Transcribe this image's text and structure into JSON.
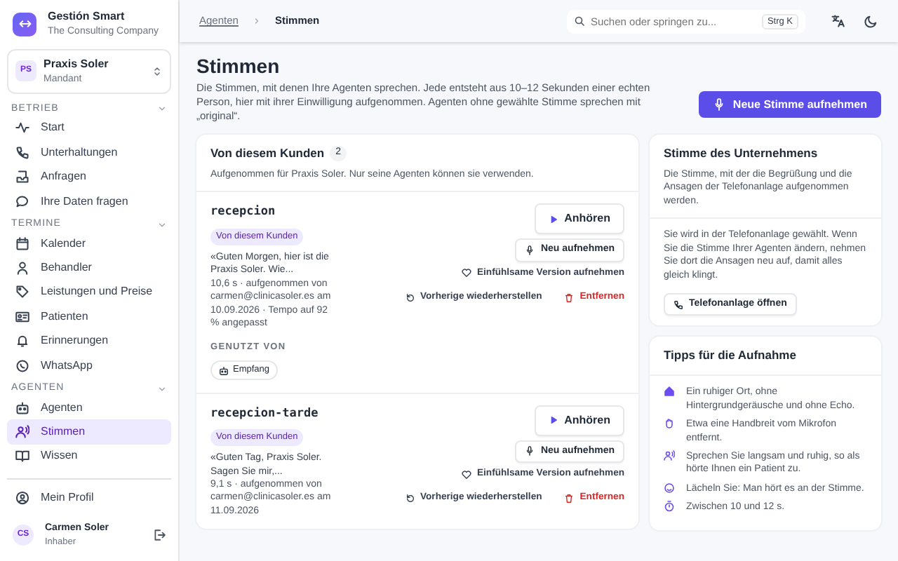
{
  "app": {
    "name": "Gestión Smart",
    "company": "The Consulting Company"
  },
  "tenant": {
    "initials": "PS",
    "name": "Praxis Soler",
    "role": "Mandant"
  },
  "sidebar": {
    "sections": [
      {
        "title": "BETRIEB",
        "expanded": true,
        "items": [
          {
            "label": "Start",
            "selected": false
          },
          {
            "label": "Unterhaltungen",
            "selected": false
          },
          {
            "label": "Anfragen",
            "selected": false
          },
          {
            "label": "Ihre Daten fragen",
            "selected": false
          }
        ]
      },
      {
        "title": "TERMINE",
        "expanded": true,
        "items": [
          {
            "label": "Kalender",
            "selected": false
          },
          {
            "label": "Behandler",
            "selected": false
          },
          {
            "label": "Leistungen und Preise",
            "selected": false
          },
          {
            "label": "Patienten",
            "selected": false
          },
          {
            "label": "Erinnerungen",
            "selected": false
          },
          {
            "label": "WhatsApp",
            "selected": false
          }
        ]
      },
      {
        "title": "AGENTEN",
        "expanded": true,
        "items": [
          {
            "label": "Agenten",
            "selected": false
          },
          {
            "label": "Stimmen",
            "selected": true
          },
          {
            "label": "Wissen",
            "selected": false
          }
        ]
      }
    ],
    "profile_link": "Mein Profil",
    "user": {
      "initials": "CS",
      "name": "Carmen Soler",
      "role": "Inhaber"
    }
  },
  "breadcrumb": [
    "Agenten",
    "Stimmen"
  ],
  "search": {
    "placeholder": "Suchen oder springen zu...",
    "shortcut": "Strg K"
  },
  "page": {
    "title": "Stimmen",
    "description": "Die Stimmen, mit denen Ihre Agenten sprechen. Jede entsteht aus 10–12 Sekunden einer echten Person, hier mit ihrer Einwilligung aufgenommen. Agenten ohne gewählte Stimme sprechen mit „original“.",
    "primary_button": "Neue Stimme aufnehmen"
  },
  "client_voices": {
    "title": "Von diesem Kunden",
    "count": "2",
    "subtitle": "Aufgenommen für Praxis Soler. Nur seine Agenten können sie verwenden.",
    "voices": [
      {
        "name": "recepcion",
        "badge": "Von diesem Kunden",
        "quote": "«Guten Morgen, hier ist die Praxis Soler. Wie...",
        "meta": "10,6 s · aufgenommen von carmen@clinicasoler.es am 10.09.2026 · Tempo auf 92 % angepasst",
        "used_by_label": "GENUTZT VON",
        "used_by": [
          "Empfang"
        ],
        "listen": "Anhören",
        "rerecord": "Neu aufnehmen",
        "empathetic": "Einfühlsame Version aufnehmen",
        "restore": "Vorherige wiederherstellen",
        "remove": "Entfernen"
      },
      {
        "name": "recepcion-tarde",
        "badge": "Von diesem Kunden",
        "quote": "«Guten Tag, Praxis Soler. Sagen Sie mir,...",
        "meta": "9,1 s · aufgenommen von carmen@clinicasoler.es am 11.09.2026",
        "listen": "Anhören",
        "rerecord": "Neu aufnehmen",
        "empathetic": "Einfühlsame Version aufnehmen",
        "restore": "Vorherige wiederherstellen",
        "remove": "Entfernen"
      }
    ]
  },
  "company_voice": {
    "title": "Stimme des Unternehmens",
    "description": "Die Stimme, mit der die Begrüßung und die Ansagen der Telefonanlage aufgenommen werden.",
    "note": "Sie wird in der Telefonanlage gewählt. Wenn Sie die Stimme Ihrer Agenten ändern, nehmen Sie dort die Ansagen neu auf, damit alles gleich klingt.",
    "button": "Telefonanlage öffnen"
  },
  "tips": {
    "title": "Tipps für die Aufnahme",
    "items": [
      "Ein ruhiger Ort, ohne Hintergrundgeräusche und ohne Echo.",
      "Etwa eine Handbreit vom Mikrofon entfernt.",
      "Sprechen Sie langsam und ruhig, so als hörte Ihnen ein Patient zu.",
      "Lächeln Sie: Man hört es an der Stimme.",
      "Zwischen 10 und 12 s."
    ]
  }
}
